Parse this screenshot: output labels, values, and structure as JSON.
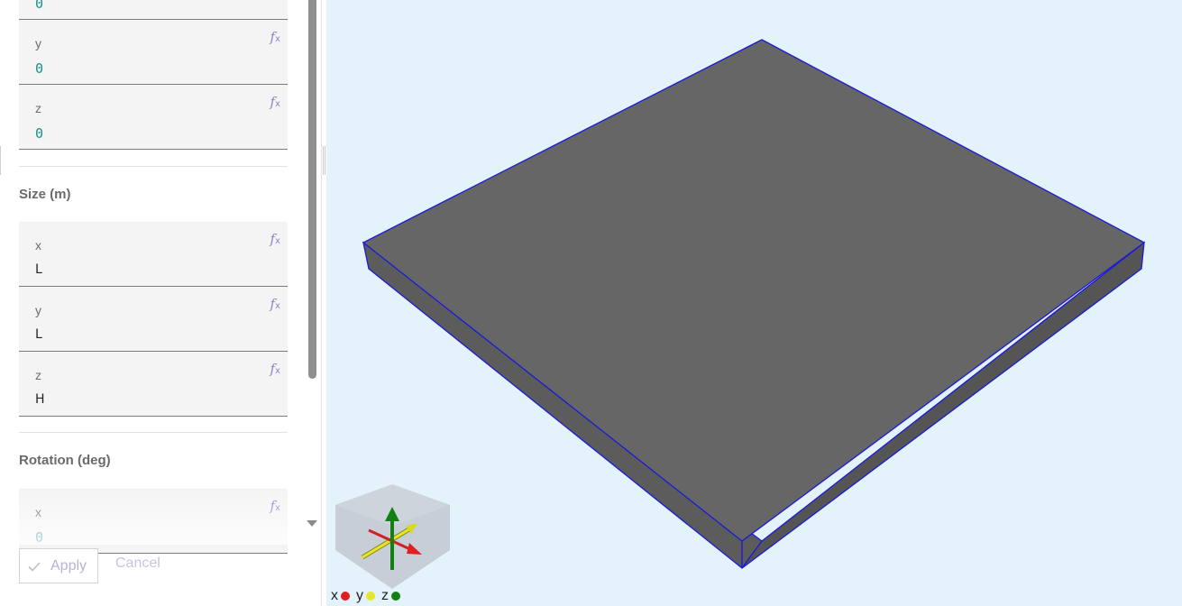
{
  "position_partial": {
    "value": "0"
  },
  "position": {
    "y": {
      "label": "y",
      "value": "0"
    },
    "z": {
      "label": "z",
      "value": "0"
    }
  },
  "size": {
    "title": "Size (m)",
    "x": {
      "label": "x",
      "value": "L"
    },
    "y": {
      "label": "y",
      "value": "L"
    },
    "z": {
      "label": "z",
      "value": "H"
    }
  },
  "rotation": {
    "title": "Rotation (deg)",
    "x": {
      "label": "x",
      "value": "0"
    }
  },
  "fx_icon": {
    "main": "f",
    "sub": "x"
  },
  "actions": {
    "apply": "Apply",
    "cancel": "Cancel"
  },
  "axes_legend": {
    "x": {
      "label": "x",
      "color": "#e02020"
    },
    "y": {
      "label": "y",
      "color": "#e6e62e"
    },
    "z": {
      "label": "z",
      "color": "#128012"
    }
  },
  "viewport": {
    "background": "#e4f2fc",
    "box_color": "#666666",
    "edge_color": "#1010d0"
  }
}
